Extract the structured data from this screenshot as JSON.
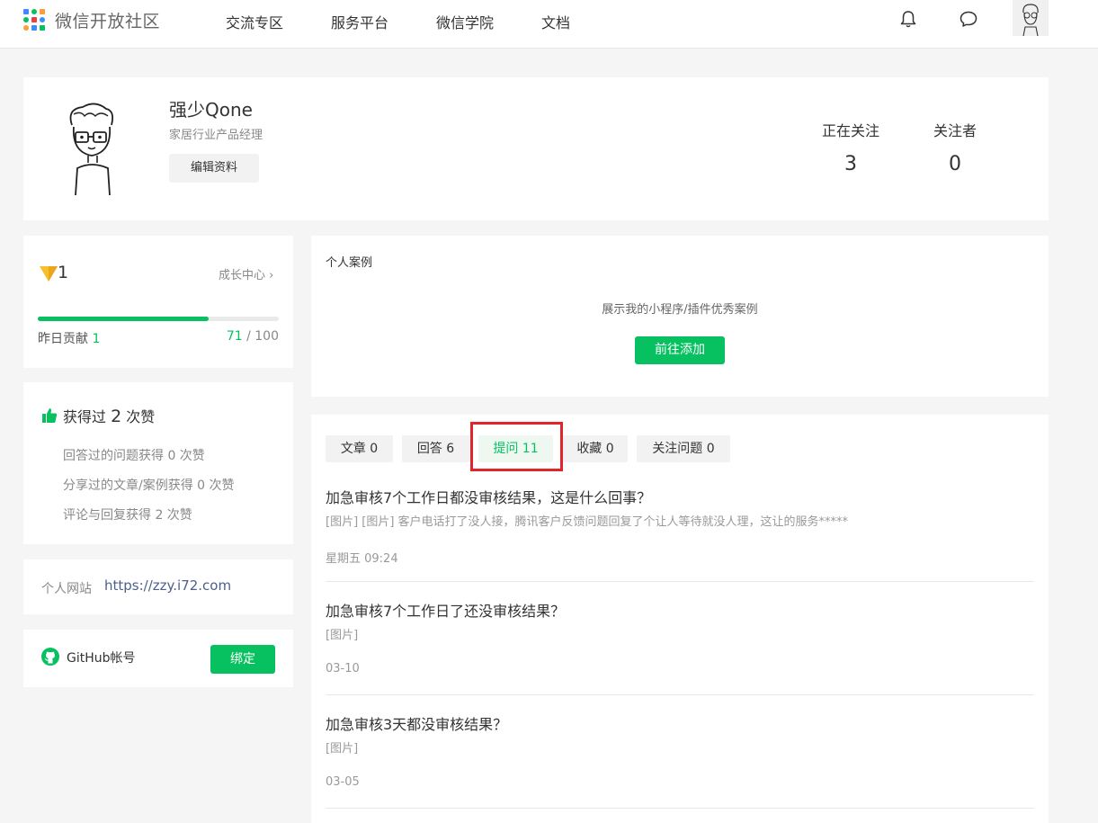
{
  "nav": {
    "brand": "微信开放社区",
    "items": [
      "交流专区",
      "服务平台",
      "微信学院",
      "文档"
    ]
  },
  "profile": {
    "name": "强少Qone",
    "title": "家居行业产品经理",
    "edit_label": "编辑资料",
    "stats": [
      {
        "label": "正在关注",
        "value": "3"
      },
      {
        "label": "关注者",
        "value": "0"
      }
    ]
  },
  "level": {
    "value": "1",
    "growth_link": "成长中心",
    "progress": 0.71,
    "contrib_label": "昨日贡献",
    "contrib_value": "1",
    "score": "71",
    "score_max": "/ 100"
  },
  "likes": {
    "prefix": "获得过",
    "count": "2",
    "suffix": "次赞",
    "rows": [
      "回答过的问题获得 0 次赞",
      "分享过的文章/案例获得 0 次赞",
      "评论与回复获得 2 次赞"
    ]
  },
  "website": {
    "label": "个人网站",
    "url": "https://zzy.i72.com"
  },
  "github": {
    "label": "GitHub帐号",
    "bind_label": "绑定"
  },
  "cases": {
    "title": "个人案例",
    "desc": "展示我的小程序/插件优秀案例",
    "add_label": "前往添加"
  },
  "tabs": [
    {
      "label": "文章 0",
      "active": false
    },
    {
      "label": "回答 6",
      "active": false
    },
    {
      "label": "提问 11",
      "active": true
    },
    {
      "label": "收藏 0",
      "active": false
    },
    {
      "label": "关注问题 0",
      "active": false
    }
  ],
  "questions": [
    {
      "title": "加急审核7个工作日都没审核结果，这是什么回事？",
      "excerpt": "[图片] [图片] 客户电话打了没人接，腾讯客户反馈问题回复了个让人等待就没人理，这让的服务*****",
      "date": "星期五 09:24"
    },
    {
      "title": "加急审核7个工作日了还没审核结果？",
      "excerpt": "[图片]",
      "date": "03-10"
    },
    {
      "title": "加急审核3天都没审核结果？",
      "excerpt": "[图片]",
      "date": "03-05"
    }
  ],
  "colors": {
    "accent": "#07c160",
    "highlight": "#e0262b",
    "link": "#4c5f8c"
  }
}
